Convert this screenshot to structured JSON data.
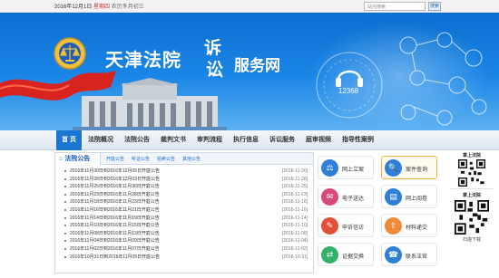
{
  "topbar": {
    "date": "2016年12月1日",
    "weekday": "星期四",
    "weather": "农历冬月初三",
    "search_placeholder": "站内搜索",
    "search_button": "搜索"
  },
  "banner": {
    "court_name": "天津法院",
    "title_char_1": "诉",
    "title_char_2": "讼",
    "title_rest": "服务网",
    "emblem_text": "SXFY",
    "hotline": "12368"
  },
  "nav": {
    "items": [
      "首 页",
      "法院概况",
      "法院公告",
      "裁判文书",
      "审判流程",
      "执行信息",
      "诉讼服务",
      "庭审视频",
      "指导性案例"
    ]
  },
  "notice": {
    "title": "法院公告",
    "tabs": [
      "开庭公告",
      "听证公告",
      "拍卖公告",
      "其他公告"
    ],
    "rows": [
      {
        "title": "2016年11月30日到2016年12月05日开庭公告",
        "date": "[2016-11-30]"
      },
      {
        "title": "2016年11月28日到2016年12月03日开庭公告",
        "date": "[2016-11-28]"
      },
      {
        "title": "2016年11月25日到2016年11月30日开庭公告",
        "date": "[2016-11-25]"
      },
      {
        "title": "2016年11月23日到2016年11月28日开庭公告",
        "date": "[2016-11-23]"
      },
      {
        "title": "2016年11月18日到2016年11月23日开庭公告",
        "date": "[2016-11-18]"
      },
      {
        "title": "2016年11月16日到2016年11月21日开庭公告",
        "date": "[2016-11-16]"
      },
      {
        "title": "2016年11月14日到2016年11月19日开庭公告",
        "date": "[2016-11-14]"
      },
      {
        "title": "2016年11月10日到2016年11月15日开庭公告",
        "date": "[2016-11-10]"
      },
      {
        "title": "2016年11月08日到2016年11月13日开庭公告",
        "date": "[2016-11-08]"
      },
      {
        "title": "2016年11月04日到2016年11月09日开庭公告",
        "date": "[2016-11-04]"
      },
      {
        "title": "2016年11月02日到2016年11月07日开庭公告",
        "date": "[2016-11-02]"
      },
      {
        "title": "2016年10月31日到2016年11月05日开庭公告",
        "date": "[2016-10-31]"
      }
    ]
  },
  "services": [
    {
      "label": "网上立案",
      "color": "#2f7fd6",
      "icon": "gavel-icon"
    },
    {
      "label": "案件查询",
      "color": "#2f7fd6",
      "icon": "search-icon"
    },
    {
      "label": "电子送达",
      "color": "#d94a7a",
      "icon": "mail-icon"
    },
    {
      "label": "网上阅卷",
      "color": "#2f7fd6",
      "icon": "document-icon"
    },
    {
      "label": "申诉信访",
      "color": "#e0503a",
      "icon": "complaint-icon"
    },
    {
      "label": "材料递交",
      "color": "#ef8a3a",
      "icon": "submit-icon"
    },
    {
      "label": "证据交换",
      "color": "#33b06a",
      "icon": "exchange-icon"
    },
    {
      "label": "联系法官",
      "color": "#2f7fd6",
      "icon": "phone-icon"
    }
  ],
  "qr": {
    "title_1": "掌上法院",
    "title_2": "掌上法院",
    "caption": "扫描下载"
  },
  "colors": {
    "banner_top": "#0a6fd0",
    "nav_active": "#1b76d1",
    "link": "#1a6bd0"
  }
}
